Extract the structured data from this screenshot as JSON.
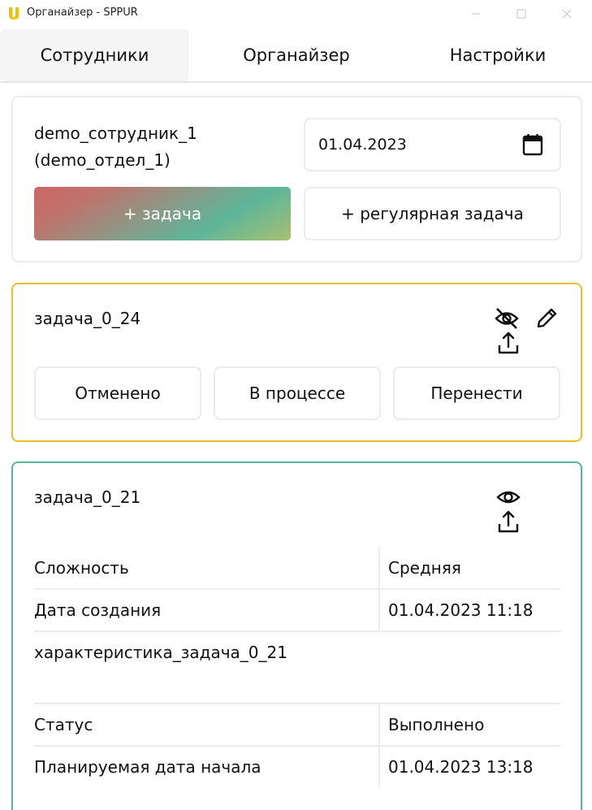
{
  "window": {
    "title": "Органайзер - SPPUR",
    "logo_color": "#f2c200"
  },
  "tabs": [
    {
      "label": "Сотрудники",
      "active": true
    },
    {
      "label": "Органайзер",
      "active": false
    },
    {
      "label": "Настройки",
      "active": false
    }
  ],
  "header_card": {
    "employee_line1": "demo_сотрудник_1",
    "employee_line2": "(demo_отдел_1)",
    "date_value": "01.04.2023",
    "add_task_label": "+ задача",
    "add_regular_task_label": "+ регулярная задача"
  },
  "task_active": {
    "title": "задача_0_24",
    "border_color": "#e8c030",
    "icons": [
      "eye-off-icon",
      "pencil-icon",
      "share-icon"
    ],
    "buttons": [
      "Отменено",
      "В процессе",
      "Перенести"
    ]
  },
  "task_done": {
    "title": "задача_0_21",
    "border_color": "#5fb09a",
    "icons": [
      "eye-icon",
      "share-icon"
    ],
    "rows": [
      {
        "key": "Сложность",
        "value": "Средняя"
      },
      {
        "key": "Дата создания",
        "value": "01.04.2023 11:18"
      }
    ],
    "description": "характеристика_задача_0_21",
    "rows2": [
      {
        "key": "Статус",
        "value": "Выполнено"
      },
      {
        "key": "Планируемая дата начала",
        "value": "01.04.2023 13:18"
      }
    ]
  }
}
